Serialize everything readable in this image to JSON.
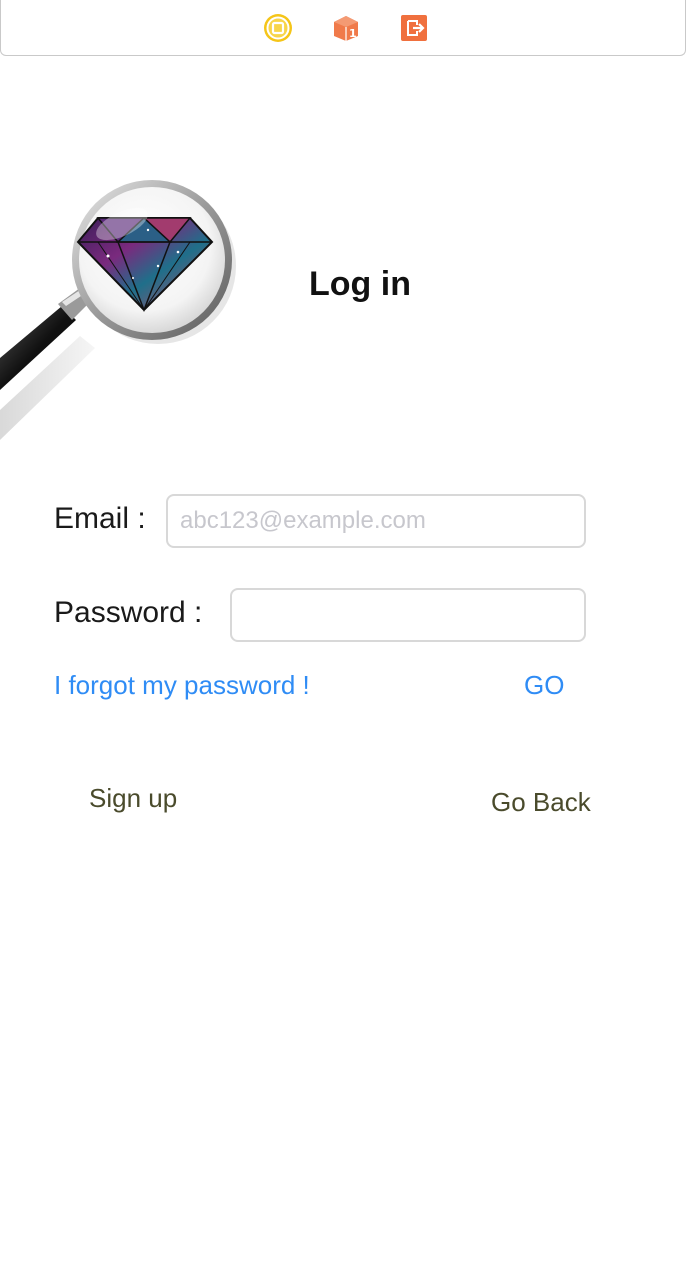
{
  "dock": {
    "icons": [
      "view-controller-icon",
      "first-responder-icon",
      "exit-icon"
    ],
    "colors": {
      "view_controller": "#f5c518",
      "first_responder": "#f07a4a",
      "exit": "#f0703e"
    }
  },
  "logo": {
    "icon": "magnifier-diamond-icon"
  },
  "title": "Log in",
  "form": {
    "email_label": "Email :",
    "email_placeholder": "abc123@example.com",
    "email_value": "",
    "password_label": "Password :",
    "password_value": ""
  },
  "actions": {
    "forgot_label": "I forgot my password !",
    "go_label": "GO",
    "signup_label": "Sign up",
    "goback_label": "Go Back"
  },
  "colors": {
    "link": "#2f8cf5",
    "nav_button": "#4a4b2c",
    "field_border": "#d8d8d8",
    "placeholder": "#c7c7cd"
  }
}
